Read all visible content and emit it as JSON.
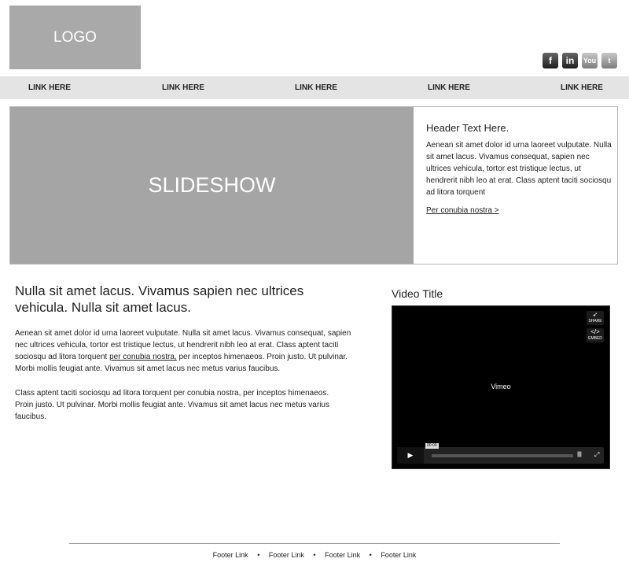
{
  "header": {
    "logo_text": "LOGO",
    "social": [
      {
        "name": "facebook-icon",
        "glyph": "f"
      },
      {
        "name": "linkedin-icon",
        "glyph": "in"
      },
      {
        "name": "youtube-icon",
        "glyph": "You"
      },
      {
        "name": "twitter-icon",
        "glyph": "t"
      }
    ]
  },
  "nav": {
    "links": [
      "LINK HERE",
      "LINK HERE",
      "LINK HERE",
      "LINK HERE",
      "LINK HERE"
    ]
  },
  "hero": {
    "slideshow_label": "SLIDESHOW",
    "title": "Header Text Here.",
    "body": "Aenean sit amet dolor id urna laoreet vulputate. Nulla sit amet lacus. Vivamus consequat, sapien nec ultrices vehicula, tortor est tristique lectus, ut hendrerit nibh leo at erat. Class aptent taciti sociosqu ad litora torquent",
    "link": "Per conubia nostra >"
  },
  "main": {
    "heading": "Nulla sit amet lacus. Vivamus sapien nec ultrices vehicula. Nulla sit amet lacus.",
    "p1_before": "Aenean sit amet dolor id urna laoreet vulputate. Nulla sit amet lacus. Vivamus consequat, sapien nec ultrices vehicula, tortor est tristique lectus, ut hendrerit nibh leo at erat. Class aptent taciti sociosqu ad litora torquent ",
    "p1_link": "per conubia nostra,",
    "p1_after": " per inceptos himenaeos. Proin justo. Ut pulvinar. Morbi mollis feugiat ante. Vivamus sit amet lacus nec metus varius faucibus.",
    "p2": "Class aptent taciti sociosqu ad litora torquent per conubia nostra, per inceptos himenaeos. Proin justo. Ut pulvinar. Morbi mollis feugiat ante. Vivamus sit amet lacus nec metus varius faucibus."
  },
  "video": {
    "title": "Video Title",
    "player_label": "Vimeo",
    "share_label": "SHARE",
    "embed_label": "EMBED",
    "timecode": "00:00"
  },
  "footer": {
    "links": [
      "Footer Link",
      "Footer Link",
      "Footer Link",
      "Footer Link"
    ],
    "separator": "•"
  }
}
